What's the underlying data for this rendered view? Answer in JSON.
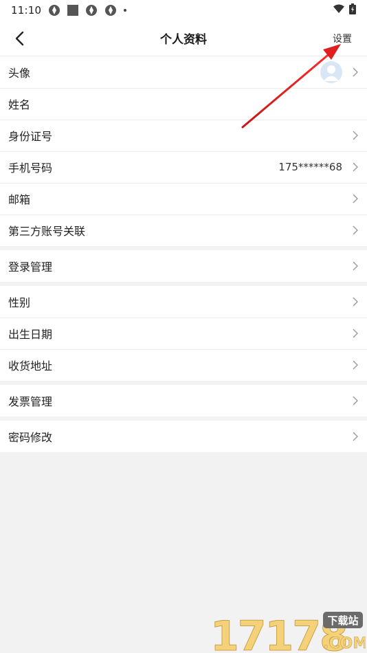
{
  "status_bar": {
    "time": "11:10",
    "notification_icons": [
      "app-notification-icon",
      "square-notification-icon",
      "app-notification-icon",
      "app-notification-icon",
      "dot-icon"
    ],
    "right_icons": [
      "wifi-icon",
      "battery-icon"
    ]
  },
  "nav": {
    "back_icon": "chevron-left-icon",
    "title": "个人资料",
    "action_label": "设置"
  },
  "groups": [
    {
      "rows": [
        {
          "key": "avatar",
          "label": "头像",
          "value": "",
          "has_avatar": true,
          "has_chevron": true
        },
        {
          "key": "name",
          "label": "姓名",
          "value": "",
          "has_chevron": false
        },
        {
          "key": "id-number",
          "label": "身份证号",
          "value": "",
          "has_chevron": true
        },
        {
          "key": "phone",
          "label": "手机号码",
          "value": "175******68",
          "has_chevron": true
        },
        {
          "key": "email",
          "label": "邮箱",
          "value": "",
          "has_chevron": true
        },
        {
          "key": "third-party",
          "label": "第三方账号关联",
          "value": "",
          "has_chevron": true
        }
      ]
    },
    {
      "rows": [
        {
          "key": "login-management",
          "label": "登录管理",
          "value": "",
          "has_chevron": true
        }
      ]
    },
    {
      "rows": [
        {
          "key": "gender",
          "label": "性别",
          "value": "",
          "has_chevron": true
        },
        {
          "key": "birthday",
          "label": "出生日期",
          "value": "",
          "has_chevron": true
        },
        {
          "key": "shipping-address",
          "label": "收货地址",
          "value": "",
          "has_chevron": true
        }
      ]
    },
    {
      "rows": [
        {
          "key": "invoice-management",
          "label": "发票管理",
          "value": "",
          "has_chevron": true
        }
      ]
    },
    {
      "rows": [
        {
          "key": "change-password",
          "label": "密码修改",
          "value": "",
          "has_chevron": true
        }
      ]
    }
  ],
  "colors": {
    "background": "#f2f2f2",
    "row_background": "#ffffff",
    "annotation_arrow": "#e02020",
    "watermark_text": "#f5d27a"
  },
  "watermark": {
    "number": "17178",
    "badge": "下载站",
    "domain": ".COM"
  }
}
